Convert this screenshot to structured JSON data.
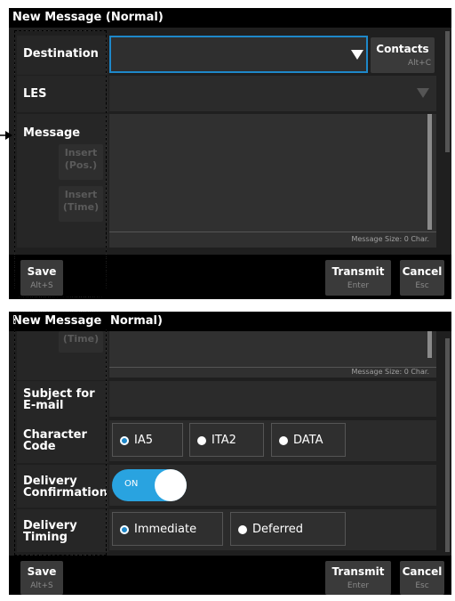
{
  "panel1": {
    "title": "New Message (Normal)",
    "destination_label": "Destination",
    "contacts": {
      "label": "Contacts",
      "shortcut": "Alt+C"
    },
    "les_label": "LES",
    "message_label": "Message",
    "insert_pos": {
      "line1": "Insert",
      "line2": "(Pos.)"
    },
    "insert_time": {
      "line1": "Insert",
      "line2": "(Time)"
    },
    "message_size": "Message Size: 0 Char.",
    "save": {
      "label": "Save",
      "shortcut": "Alt+S"
    },
    "transmit": {
      "label": "Transmit",
      "shortcut": "Enter"
    },
    "cancel": {
      "label": "Cancel",
      "shortcut": "Esc"
    }
  },
  "panel2": {
    "title_left": "New Message",
    "title_right": "Normal)",
    "partial_button": "(Time)",
    "message_size": "Message Size: 0 Char.",
    "subject_label_1": "Subject for",
    "subject_label_2": "E-mail",
    "charcode_label_1": "Character",
    "charcode_label_2": "Code",
    "charcode_options": [
      "IA5",
      "ITA2",
      "DATA"
    ],
    "charcode_selected": "IA5",
    "delivery_conf_label_1": "Delivery",
    "delivery_conf_label_2": "Confirmation",
    "toggle_text": "ON",
    "delivery_timing_label_1": "Delivery",
    "delivery_timing_label_2": "Timing",
    "timing_options": [
      "Immediate",
      "Deferred"
    ],
    "timing_selected": "Immediate",
    "save": {
      "label": "Save",
      "shortcut": "Alt+S"
    },
    "transmit": {
      "label": "Transmit",
      "shortcut": "Enter"
    },
    "cancel": {
      "label": "Cancel",
      "shortcut": "Esc"
    }
  },
  "colors": {
    "accent": "#1e88c9",
    "toggle": "#29a3e0",
    "panel": "#1f1f1f"
  }
}
